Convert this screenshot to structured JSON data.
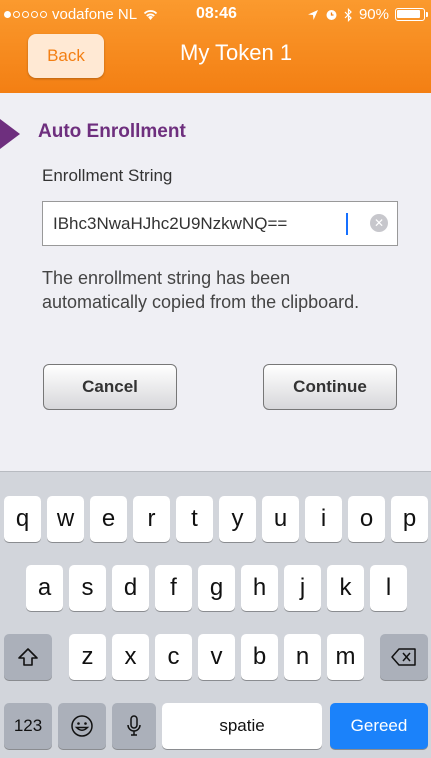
{
  "status_bar": {
    "carrier": "vodafone NL",
    "time": "08:46",
    "battery": "90%",
    "battery_level": 0.9,
    "signal_dots_filled": 1
  },
  "nav": {
    "back_label": "Back",
    "title": "My Token 1"
  },
  "section": {
    "title": "Auto Enrollment"
  },
  "field": {
    "label": "Enrollment String",
    "value": "IBhc3NwaHJhc2U9NzkwNQ=="
  },
  "info_text": "The enrollment string has been automatically copied from the clipboard.",
  "buttons": {
    "cancel": "Cancel",
    "continue": "Continue"
  },
  "keyboard": {
    "row1": [
      "q",
      "w",
      "e",
      "r",
      "t",
      "y",
      "u",
      "i",
      "o",
      "p"
    ],
    "row2": [
      "a",
      "s",
      "d",
      "f",
      "g",
      "h",
      "j",
      "k",
      "l"
    ],
    "row3": [
      "z",
      "x",
      "c",
      "v",
      "b",
      "n",
      "m"
    ],
    "numbers_key": "123",
    "space_key": "spatie",
    "return_key": "Gereed"
  },
  "colors": {
    "header": "#f37f13",
    "accent_purple": "#6e2f7e",
    "return_blue": "#1b82fa"
  }
}
